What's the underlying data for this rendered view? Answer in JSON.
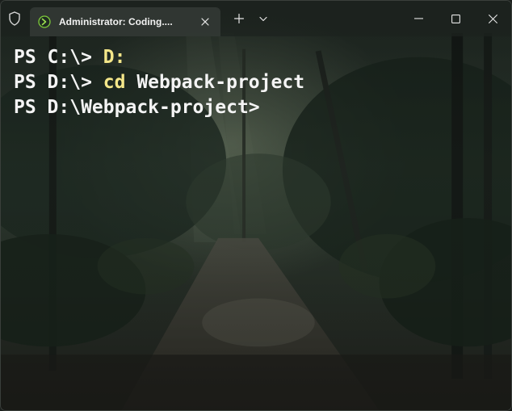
{
  "window": {
    "tab_title": "Administrator: Coding...."
  },
  "icons": {
    "shield": "shield-icon",
    "tab": "powershell-icon",
    "tab_close": "close-icon",
    "new_tab": "plus-icon",
    "dropdown": "chevron-down-icon",
    "minimize": "minimize-icon",
    "maximize": "maximize-icon",
    "close": "close-icon"
  },
  "terminal": {
    "lines": [
      {
        "prompt": "PS C:\\> ",
        "command": "D:"
      },
      {
        "prompt": "PS D:\\> ",
        "command": "cd",
        "arg": " Webpack-project"
      },
      {
        "prompt": "PS D:\\Webpack-project>",
        "command": ""
      }
    ]
  },
  "colors": {
    "prompt": "#f4f4f4",
    "command": "#f4e689",
    "titlebar": "#1c221e",
    "tab": "#323834"
  }
}
